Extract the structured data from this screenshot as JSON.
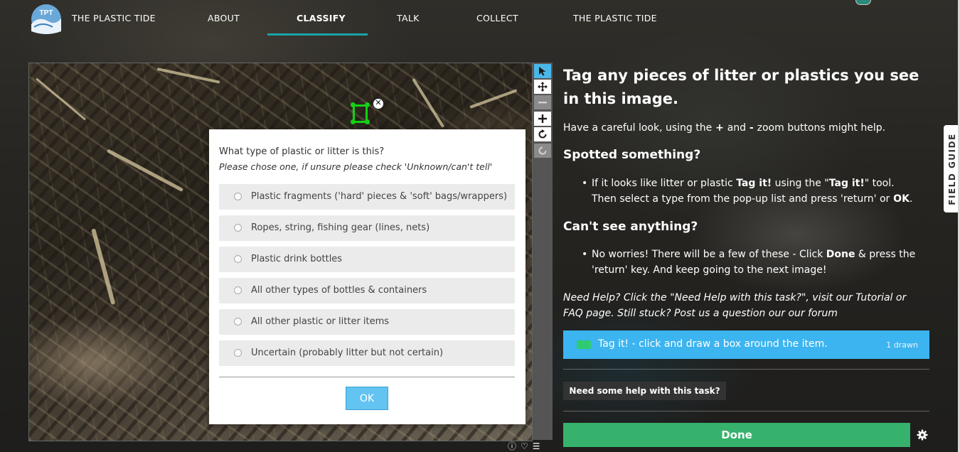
{
  "nav": {
    "logo_text": "TPT",
    "items": [
      "THE PLASTIC TIDE",
      "ABOUT",
      "CLASSIFY",
      "TALK",
      "COLLECT",
      "THE PLASTIC TIDE"
    ],
    "active_index": 2
  },
  "popup": {
    "question": "What type of plastic or litter is this?",
    "instruction": "Please chose one, if unsure please check 'Unknown/can't tell'",
    "options": [
      "Plastic fragments ('hard' pieces & 'soft' bags/wrappers)",
      "Ropes, string, fishing gear (lines, nets)",
      "Plastic drink bottles",
      "All other types of bottles & containers",
      "All other plastic or litter items",
      "Uncertain (probably litter but not certain)"
    ],
    "ok_label": "OK"
  },
  "task": {
    "title": "Tag any pieces of litter or plastics you see in this image.",
    "zoom_hint": "Have a careful look, using the + and - zoom buttons might help.",
    "spotted_heading": "Spotted something?",
    "spotted_bullet": "If it looks like litter or plastic Tag it! using the \"Tag it!\" tool. Then select a type from the pop-up list and press 'return' or OK.",
    "cant_heading": "Can't see anything?",
    "cant_bullet": "No worries! There will be a few of these - Click Done & press the 'return' key. And keep going to the next image!",
    "help_text": "Need Help? Click the \"Need Help with this task?\", visit our Tutorial or FAQ page. Still stuck? Post us a question our our forum",
    "tool_label": "Tag it! - click and draw a box around the item.",
    "tool_count": "1 drawn",
    "tool_color": "#2ecc71",
    "help_button": "Need some help with this task?",
    "done_button": "Done"
  },
  "field_guide": "FIELD GUIDE",
  "colors": {
    "accent": "#1aa3a8",
    "tool_bg": "#3cb4f0",
    "done": "#37b26c",
    "mark": "#14d114"
  }
}
